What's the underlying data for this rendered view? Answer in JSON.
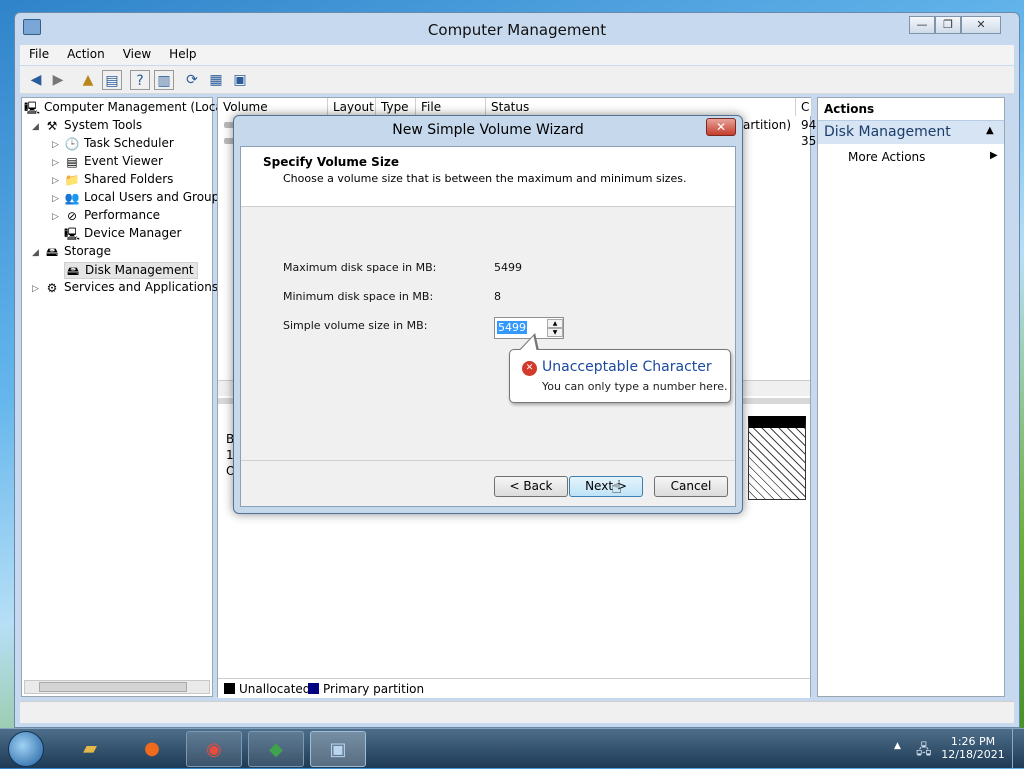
{
  "window": {
    "title": "Computer Management",
    "minimize": "—",
    "maximize": "❐",
    "close": "✕"
  },
  "menu": [
    "File",
    "Action",
    "View",
    "Help"
  ],
  "tree": {
    "root": "Computer Management (Local",
    "system_tools": "System Tools",
    "task_scheduler": "Task Scheduler",
    "event_viewer": "Event Viewer",
    "shared_folders": "Shared Folders",
    "local_users": "Local Users and Groups",
    "performance": "Performance",
    "device_manager": "Device Manager",
    "storage": "Storage",
    "disk_management": "Disk Management",
    "services": "Services and Applications"
  },
  "columns": [
    "Volume",
    "Layout",
    "Type",
    "File System",
    "Status",
    "C"
  ],
  "partial_text": {
    "row1_status": "artition)",
    "row1_c": "94",
    "row2_c": "35",
    "lower_b": "B",
    "lower_1": "1(",
    "lower_o": "O"
  },
  "legend": {
    "unallocated": "Unallocated",
    "primary": "Primary partition",
    "unallocated_color": "#000000",
    "primary_color": "#000080"
  },
  "actions": {
    "header": "Actions",
    "section": "Disk Management",
    "more": "More Actions"
  },
  "dialog": {
    "title": "New Simple Volume Wizard",
    "close": "✕",
    "heading": "Specify Volume Size",
    "subheading": "Choose a volume size that is between the maximum and minimum sizes.",
    "max_label": "Maximum disk space in MB:",
    "max_value": "5499",
    "min_label": "Minimum disk space in MB:",
    "min_value": "8",
    "size_label": "Simple volume size in MB:",
    "size_value": "5499",
    "back": "< Back",
    "next": "Next >",
    "cancel": "Cancel"
  },
  "tooltip": {
    "title": "Unacceptable Character",
    "message": "You can only type a number here."
  },
  "clock": {
    "time": "1:26 PM",
    "date": "12/18/2021"
  }
}
